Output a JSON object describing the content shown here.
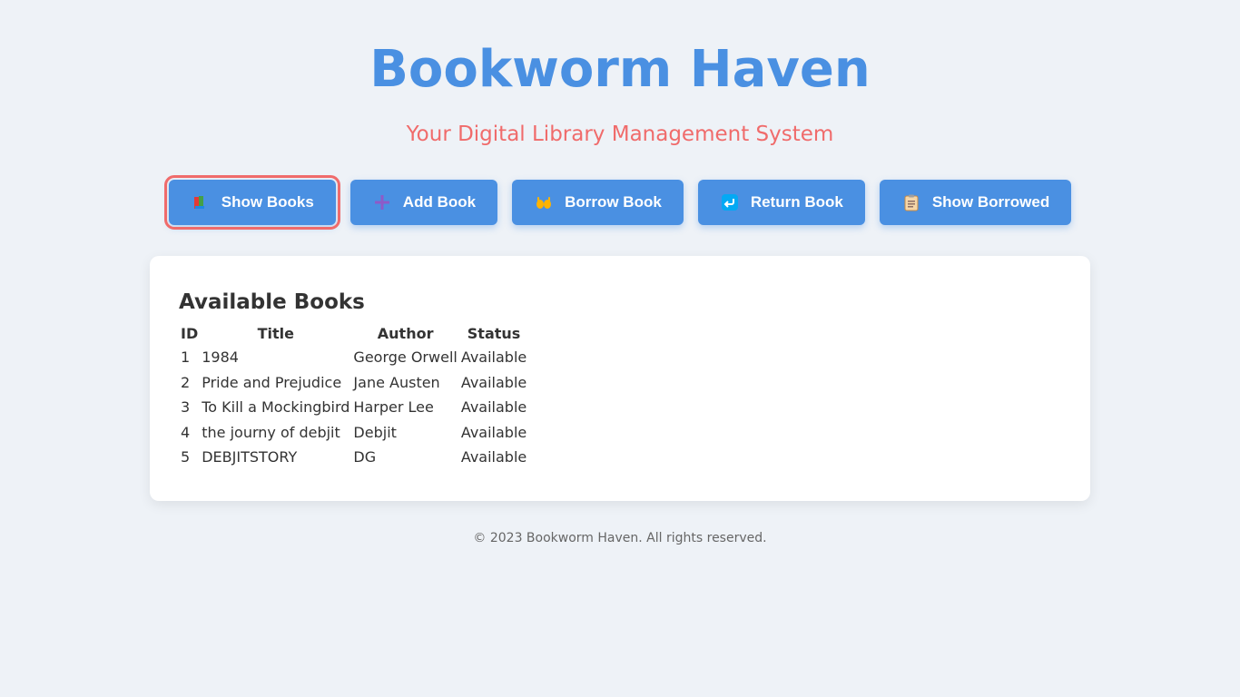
{
  "header": {
    "title": "Bookworm Haven",
    "subtitle": "Your Digital Library Management System"
  },
  "actions": [
    {
      "label": "Show Books",
      "icon": "books-icon",
      "active": true
    },
    {
      "label": "Add Book",
      "icon": "plus-icon",
      "active": false
    },
    {
      "label": "Borrow Book",
      "icon": "raised-hands-icon",
      "active": false
    },
    {
      "label": "Return Book",
      "icon": "return-arrow-icon",
      "active": false
    },
    {
      "label": "Show Borrowed",
      "icon": "clipboard-icon",
      "active": false
    }
  ],
  "books_panel": {
    "title": "Available Books",
    "columns": [
      "ID",
      "Title",
      "Author",
      "Status"
    ],
    "rows": [
      {
        "id": "1",
        "title": "1984",
        "author": "George Orwell",
        "status": "Available"
      },
      {
        "id": "2",
        "title": "Pride and Prejudice",
        "author": "Jane Austen",
        "status": "Available"
      },
      {
        "id": "3",
        "title": "To Kill a Mockingbird",
        "author": "Harper Lee",
        "status": "Available"
      },
      {
        "id": "4",
        "title": "the journy of debjit",
        "author": "Debjit",
        "status": "Available"
      },
      {
        "id": "5",
        "title": "DEBJITSTORY",
        "author": "DG",
        "status": "Available"
      }
    ]
  },
  "footer": {
    "text": "© 2023 Bookworm Haven. All rights reserved."
  },
  "colors": {
    "primary": "#4a90e2",
    "accent": "#f06b6b",
    "background": "#eef2f7"
  }
}
